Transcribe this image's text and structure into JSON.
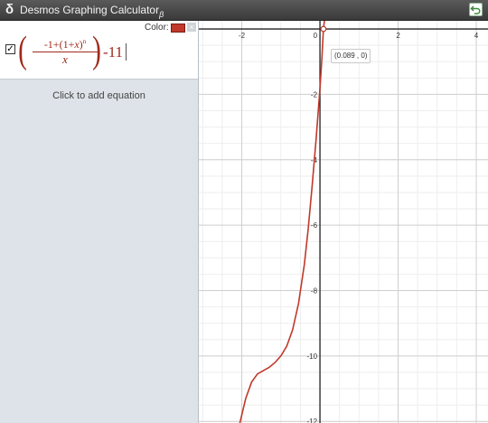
{
  "window": {
    "title": "Desmos Graphing Calculator",
    "beta": "β",
    "logo": "desmos-logo-icon",
    "undo_icon": "undo-icon"
  },
  "expression": {
    "checked": true,
    "checkbox_glyph": "✓",
    "color_label": "Color:",
    "color": "#c0392b",
    "hide_icon": "×",
    "numerator_a": "-1+(1+",
    "numerator_x": "x",
    "numerator_b": ")",
    "numerator_exp": "n",
    "denominator": "x",
    "tail": "-11"
  },
  "sidebar": {
    "add_equation": "Click to add equation"
  },
  "graph": {
    "x_ticks": [
      "-2",
      "0",
      "2",
      "4"
    ],
    "y_ticks": [
      "-2",
      "-4",
      "-6",
      "-8",
      "-10",
      "-12"
    ],
    "point_label": "(0.089 , 0)",
    "curve_color": "#c0392b"
  },
  "chart_data": {
    "type": "line",
    "xlim": [
      -3.1,
      4.3
    ],
    "ylim": [
      -12.05,
      0.25
    ],
    "x_ticks": [
      -2,
      0,
      2,
      4
    ],
    "y_ticks": [
      -2,
      -4,
      -6,
      -8,
      -10,
      -12
    ],
    "grid": true,
    "series": [
      {
        "x": [
          -2.05,
          -1.9,
          -1.75,
          -1.6,
          -1.45,
          -1.3,
          -1.15,
          -1.0,
          -0.85,
          -0.7,
          -0.55,
          -0.4,
          -0.3,
          -0.2,
          -0.1,
          0.0,
          0.05,
          0.089,
          0.12
        ],
        "values": [
          -12.05,
          -11.3,
          -10.8,
          -10.55,
          -10.45,
          -10.35,
          -10.2,
          -10.0,
          -9.7,
          -9.2,
          -8.4,
          -7.2,
          -6.1,
          -4.8,
          -3.4,
          -1.8,
          -0.9,
          0.0,
          0.3
        ]
      }
    ],
    "highlighted_point": {
      "x": 0.089,
      "y": 0,
      "label": "(0.089 , 0)"
    }
  }
}
